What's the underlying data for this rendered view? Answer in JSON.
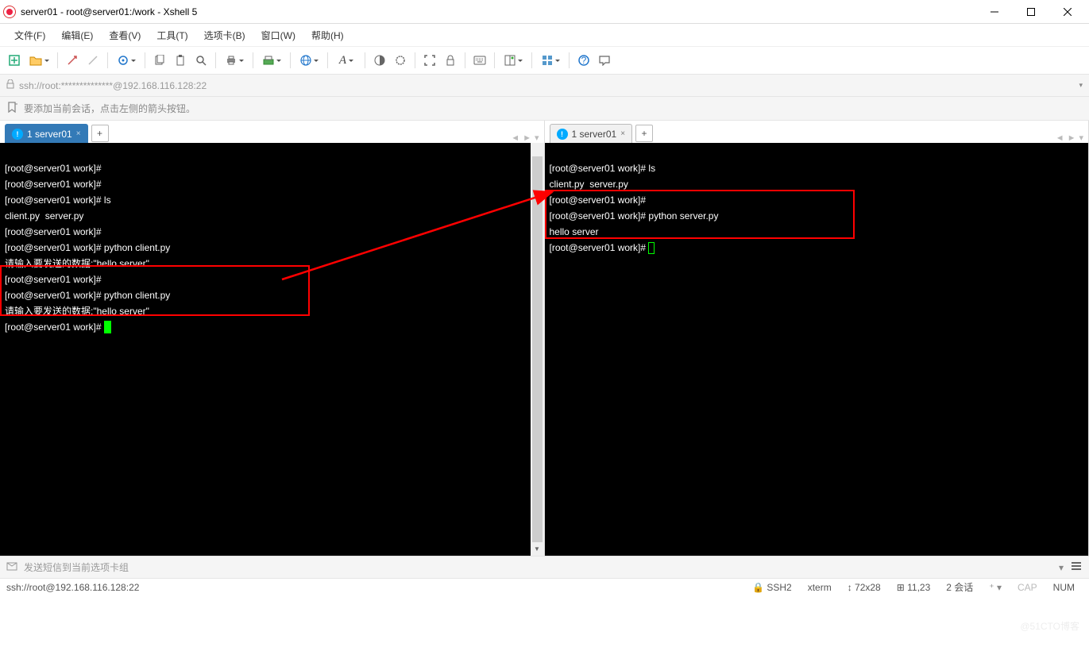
{
  "window": {
    "title": "server01 - root@server01:/work - Xshell 5"
  },
  "menu": {
    "file": "文件(F)",
    "edit": "编辑(E)",
    "view": "查看(V)",
    "tools": "工具(T)",
    "tab": "选项卡(B)",
    "window": "窗口(W)",
    "help": "帮助(H)"
  },
  "address": {
    "url": "ssh://root:**************@192.168.116.128:22"
  },
  "session_hint": "要添加当前会话，点击左侧的箭头按钮。",
  "tabs": {
    "left": {
      "label": "1 server01"
    },
    "right": {
      "label": "1 server01"
    }
  },
  "terminal_left": {
    "l1": "[root@server01 work]#",
    "l2": "[root@server01 work]#",
    "l3p": "[root@server01 work]# ",
    "l3c": "ls",
    "l4": "client.py  server.py",
    "l5": "[root@server01 work]#",
    "l6p": "[root@server01 work]# ",
    "l6c": "python client.py",
    "l7": "请输入要发送的数据:\"hello server\"",
    "l8": "[root@server01 work]#",
    "l9p": "[root@server01 work]# ",
    "l9c": "python client.py",
    "l10": "请输入要发送的数据:\"hello server\"",
    "l11": "[root@server01 work]# "
  },
  "terminal_right": {
    "l1p": "[root@server01 work]# ",
    "l1c": "ls",
    "l2": "client.py  server.py",
    "l3": "[root@server01 work]#",
    "l4p": "[root@server01 work]# ",
    "l4c": "python server.py",
    "l5": "hello server",
    "l6": "[root@server01 work]# "
  },
  "input_hint": "发送短信到当前选项卡组",
  "status": {
    "conn": "ssh://root@192.168.116.128:22",
    "proto": "SSH2",
    "term": "xterm",
    "size": "72x28",
    "pos": "11,23",
    "sessions": "2 会话",
    "cap": "CAP",
    "num": "NUM"
  },
  "watermark": "@51CTO博客"
}
